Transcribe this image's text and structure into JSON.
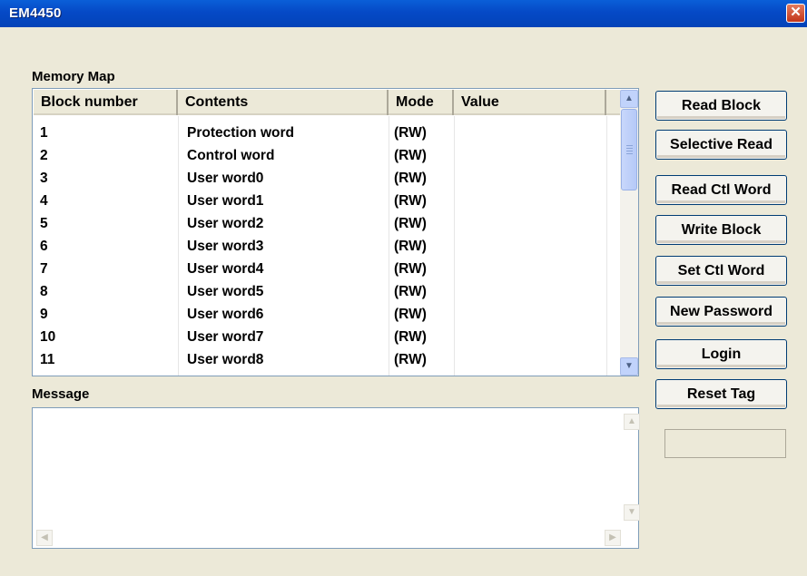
{
  "window": {
    "title": "EM4450",
    "close_glyph": "✕"
  },
  "memory_map": {
    "label": "Memory Map",
    "columns": [
      "Block number",
      "Contents",
      "Mode",
      "Value"
    ],
    "rows": [
      {
        "block": "1",
        "contents": "Protection word",
        "mode": "(RW)",
        "value": ""
      },
      {
        "block": "2",
        "contents": "Control word",
        "mode": "(RW)",
        "value": ""
      },
      {
        "block": "3",
        "contents": "User word0",
        "mode": "(RW)",
        "value": ""
      },
      {
        "block": "4",
        "contents": "User word1",
        "mode": "(RW)",
        "value": ""
      },
      {
        "block": "5",
        "contents": "User word2",
        "mode": "(RW)",
        "value": ""
      },
      {
        "block": "6",
        "contents": "User word3",
        "mode": "(RW)",
        "value": ""
      },
      {
        "block": "7",
        "contents": "User word4",
        "mode": "(RW)",
        "value": ""
      },
      {
        "block": "8",
        "contents": "User word5",
        "mode": "(RW)",
        "value": ""
      },
      {
        "block": "9",
        "contents": "User word6",
        "mode": "(RW)",
        "value": ""
      },
      {
        "block": "10",
        "contents": "User word7",
        "mode": "(RW)",
        "value": ""
      },
      {
        "block": "11",
        "contents": "User word8",
        "mode": "(RW)",
        "value": ""
      }
    ]
  },
  "message": {
    "label": "Message",
    "text": ""
  },
  "buttons": {
    "read_block": "Read Block",
    "selective_read": "Selective Read",
    "read_ctl_word": "Read Ctl Word",
    "write_block": "Write Block",
    "set_ctl_word": "Set Ctl Word",
    "new_password": "New Password",
    "login": "Login",
    "reset_tag": "Reset Tag"
  },
  "status": {
    "text": ""
  },
  "icons": {
    "up": "▲",
    "down": "▼",
    "left": "◀",
    "right": "▶",
    "scroll_up_icon": "chevron-up-icon",
    "scroll_down_icon": "chevron-down-icon"
  },
  "colors": {
    "title_bar": "#0549c6",
    "window_bg": "#ece9d8",
    "button_border": "#003c74"
  }
}
